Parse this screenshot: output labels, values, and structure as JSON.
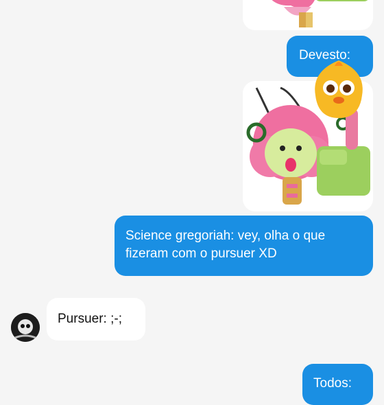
{
  "messages": [
    {
      "type": "sticker",
      "direction": "outgoing",
      "description": "creature-with-finger-sticker-top"
    },
    {
      "type": "text",
      "direction": "outgoing",
      "text": "Devesto:"
    },
    {
      "type": "sticker",
      "direction": "outgoing",
      "description": "creature-with-finger-sticker"
    },
    {
      "type": "text",
      "direction": "outgoing",
      "text": "Science gregoriah: vey, olha o que fizeram com o pursuer XD"
    },
    {
      "type": "text",
      "direction": "incoming",
      "text": "Pursuer: ;-;"
    },
    {
      "type": "text",
      "direction": "outgoing",
      "text": "Todos:"
    }
  ],
  "colors": {
    "background": "#f5f5f5",
    "outgoing_bubble": "#1a8fe3",
    "incoming_bubble": "#ffffff"
  }
}
